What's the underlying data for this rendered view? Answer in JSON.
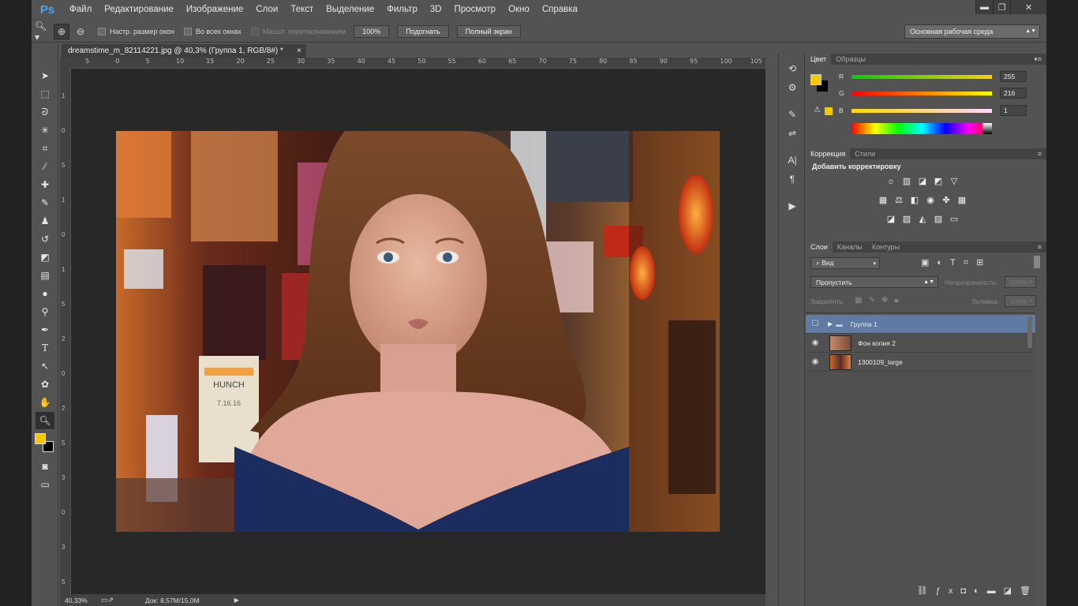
{
  "app": {
    "logo": "Ps"
  },
  "menu": [
    "Файл",
    "Редактирование",
    "Изображение",
    "Слои",
    "Текст",
    "Выделение",
    "Фильтр",
    "3D",
    "Просмотр",
    "Окно",
    "Справка"
  ],
  "window_controls": {
    "minimize": "▬",
    "restore": "❐",
    "close": "✕"
  },
  "options": {
    "resize_windows": "Настр. размер окон",
    "all_windows": "Во всех окнах",
    "scrubby_zoom": "Масшт. перетаскиванием",
    "btn_100": "100%",
    "btn_fit": "Подогнать",
    "btn_full": "Полный экран",
    "workspace": "Основная рабочая среда"
  },
  "document": {
    "tab_title": "dreamstime_m_82114221.jpg @ 40,3% (Группа 1, RGB/8#) *",
    "zoom": "40,33%",
    "doc_size": "Док: 8,57M/15,0M"
  },
  "ruler": {
    "top": [
      "5",
      "0",
      "5",
      "10",
      "15",
      "20",
      "25",
      "30",
      "35",
      "40",
      "45",
      "50",
      "55",
      "60",
      "65",
      "70",
      "75",
      "80",
      "85",
      "90",
      "95",
      "100",
      "105"
    ],
    "left": [
      "1",
      "0",
      "5",
      "1",
      "0",
      "1",
      "5",
      "2",
      "0",
      "2",
      "5",
      "3",
      "0",
      "3",
      "5"
    ]
  },
  "color_panel": {
    "tabs": [
      "Цвет",
      "Образцы"
    ],
    "fg_color": "#f7c800",
    "bg_color": "#000000",
    "r_label": "R",
    "g_label": "G",
    "b_label": "B",
    "r": "255",
    "g": "216",
    "b": "1"
  },
  "adjust_panel": {
    "tabs": [
      "Коррекция",
      "Стили"
    ],
    "heading": "Добавить корректировку"
  },
  "layers_panel": {
    "tabs": [
      "Слои",
      "Каналы",
      "Контуры"
    ],
    "filter": "Вид",
    "blend_mode": "Пропустить",
    "opacity_label": "Непрозрачность:",
    "opacity_value": "100%",
    "lock_label": "Закрепить:",
    "fill_label": "Заливка:",
    "fill_value": "100%",
    "layers": [
      {
        "name": "Группа 1",
        "selected": true
      },
      {
        "name": "Фон копия 2",
        "selected": false
      },
      {
        "name": "1300109_large",
        "selected": false
      }
    ]
  },
  "canvas_text": {
    "sign": "HUNCH",
    "sign2": "7.16.16"
  }
}
